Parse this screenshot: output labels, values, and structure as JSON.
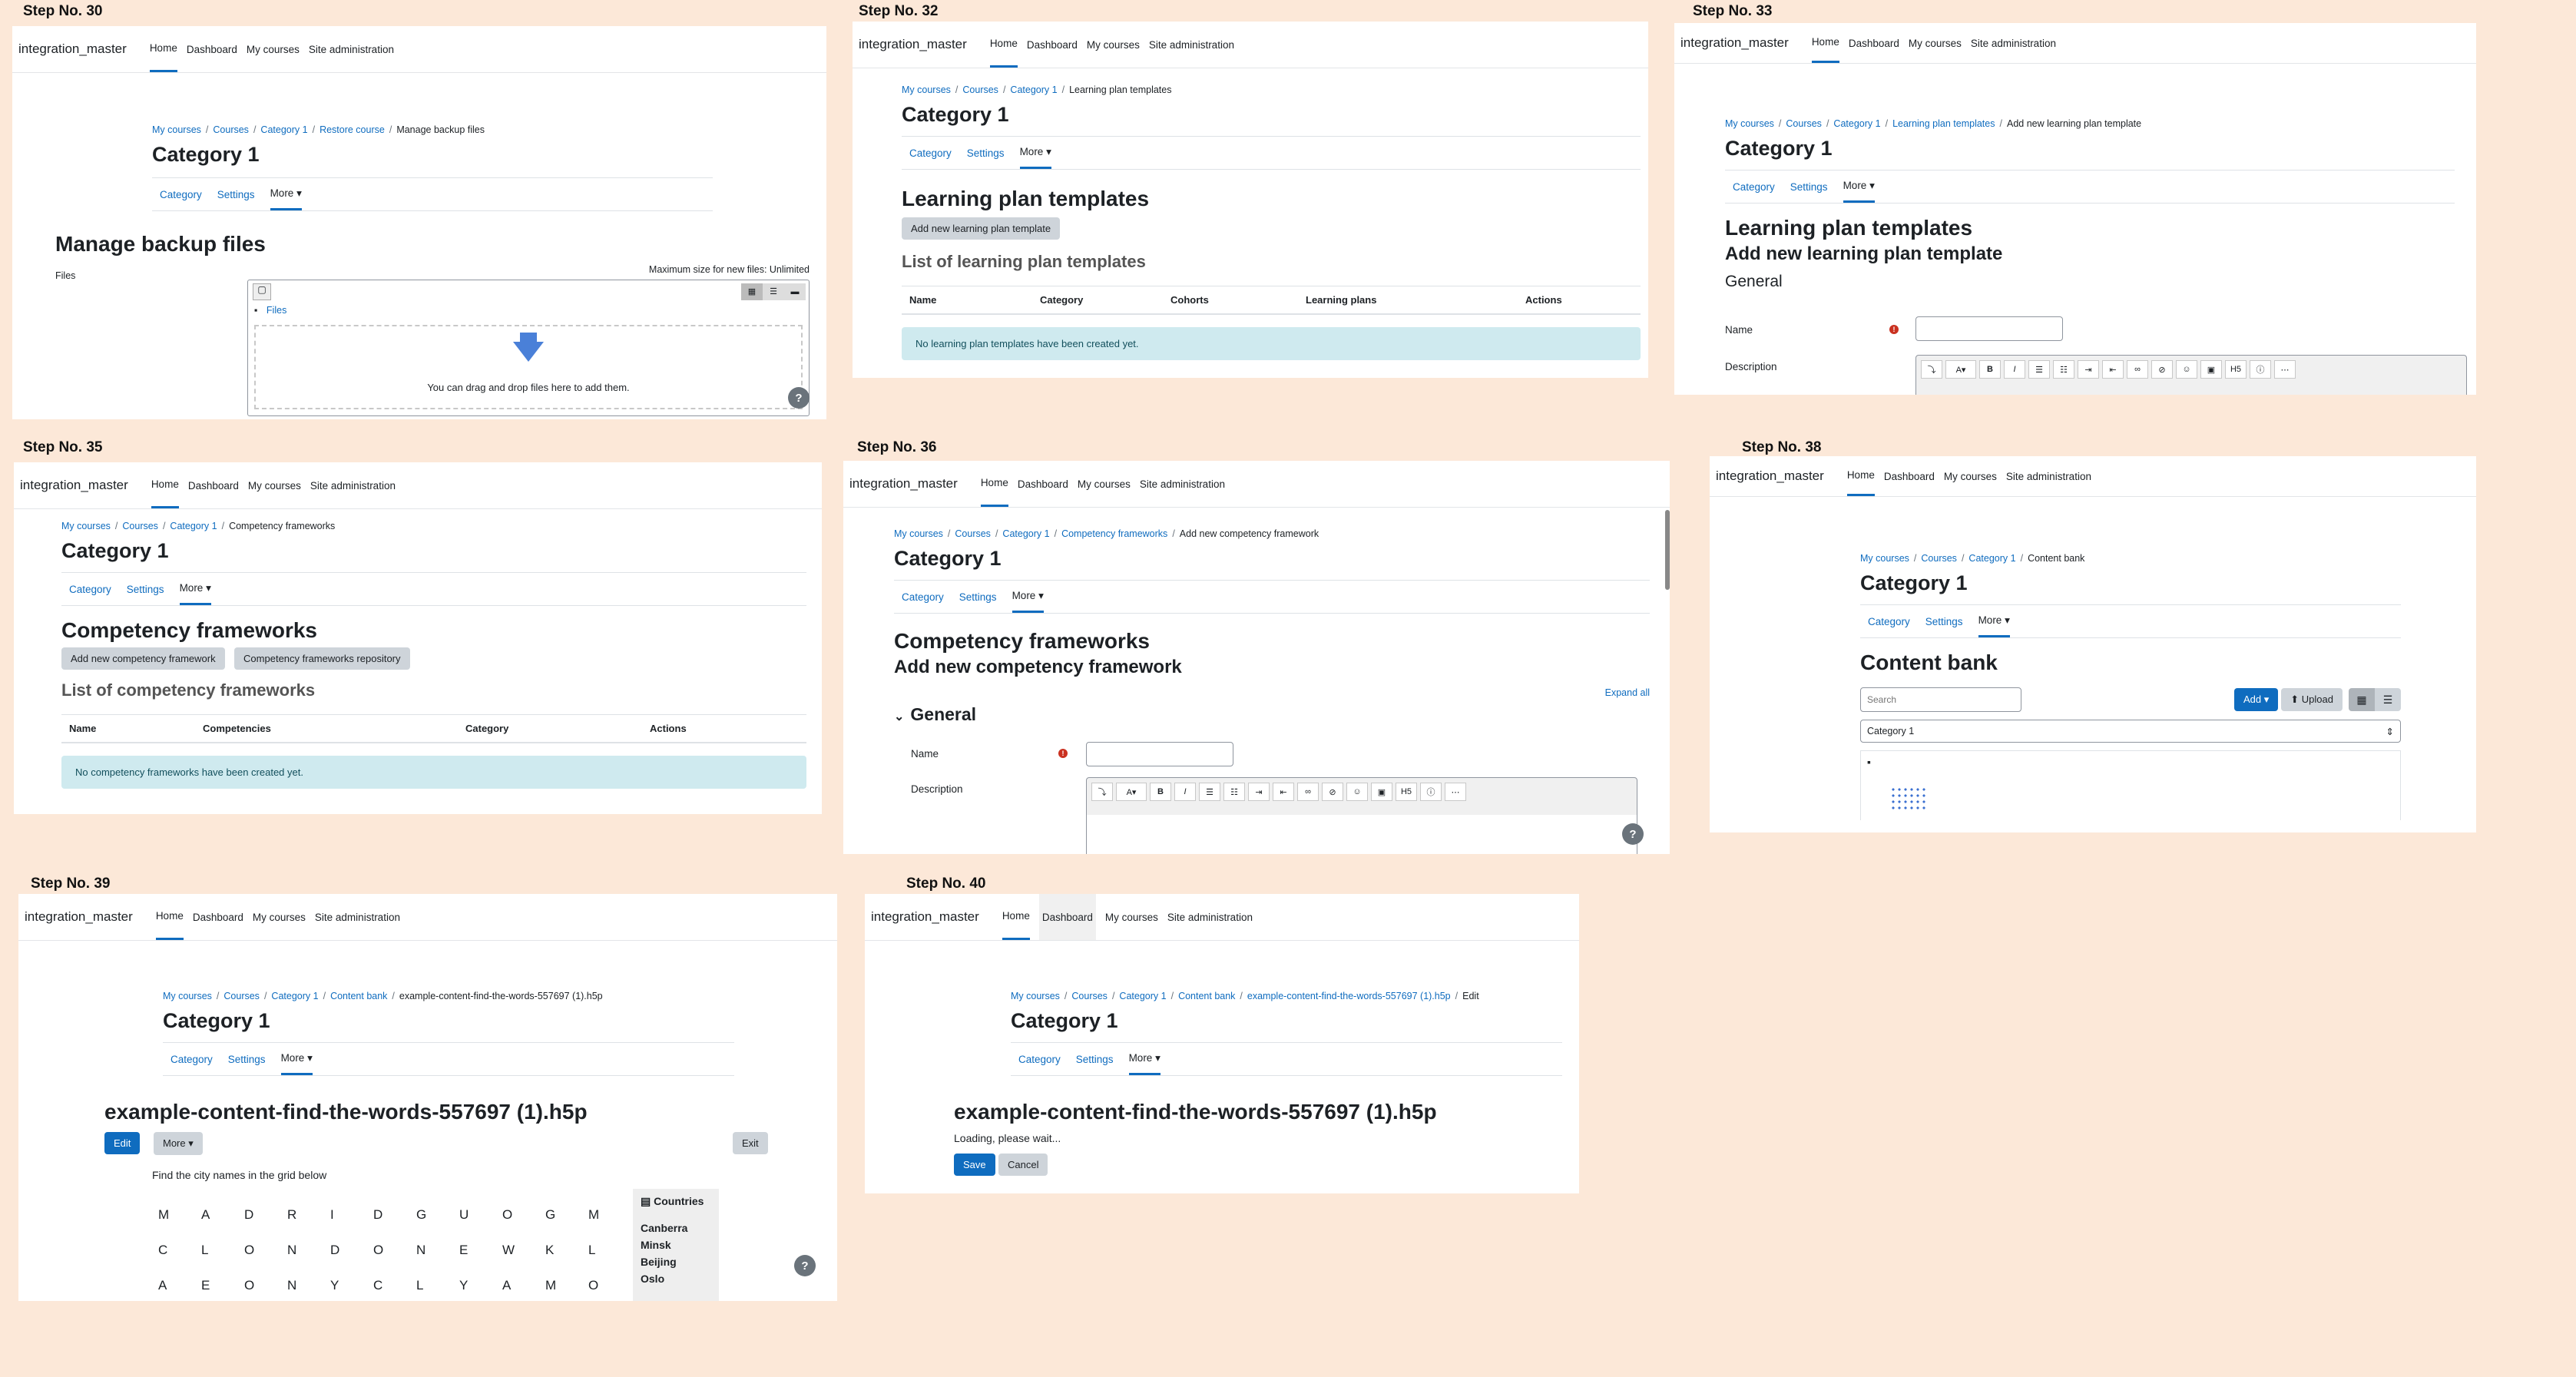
{
  "common": {
    "brand": "integration_master",
    "nav": [
      "Home",
      "Dashboard",
      "My courses",
      "Site administration"
    ],
    "category_title": "Category 1",
    "subnav": [
      "Category",
      "Settings",
      "More ▾"
    ],
    "crumb_mycourses": "My courses",
    "crumb_courses": "Courses",
    "crumb_category": "Category 1",
    "help": "?"
  },
  "s30": {
    "label": "Step No. 30",
    "crumb_restore": "Restore course",
    "crumb_current": "Manage backup files",
    "heading": "Manage backup files",
    "max_size": "Maximum size for new files: Unlimited",
    "files_label": "Files",
    "files_folder": "Files",
    "drop_text": "You can drag and drop files here to add them."
  },
  "s32": {
    "label": "Step No. 32",
    "crumb_current": "Learning plan templates",
    "heading": "Learning plan templates",
    "add_button": "Add new learning plan template",
    "list_heading": "List of learning plan templates",
    "columns": [
      "Name",
      "Category",
      "Cohorts",
      "Learning plans",
      "Actions"
    ],
    "empty": "No learning plan templates have been created yet."
  },
  "s33": {
    "label": "Step No. 33",
    "crumb_templates": "Learning plan templates",
    "crumb_current": "Add new learning plan template",
    "heading": "Learning plan templates",
    "subheading": "Add new learning plan template",
    "section": "General",
    "name_label": "Name",
    "desc_label": "Description"
  },
  "s35": {
    "label": "Step No. 35",
    "crumb_current": "Competency frameworks",
    "heading": "Competency frameworks",
    "add_button": "Add new competency framework",
    "repo_button": "Competency frameworks repository",
    "list_heading": "List of competency frameworks",
    "columns": [
      "Name",
      "Competencies",
      "Category",
      "Actions"
    ],
    "empty": "No competency frameworks have been created yet."
  },
  "s36": {
    "label": "Step No. 36",
    "crumb_frameworks": "Competency frameworks",
    "crumb_current": "Add new competency framework",
    "heading": "Competency frameworks",
    "subheading": "Add new competency framework",
    "expand_all": "Expand all",
    "section": "General",
    "name_label": "Name",
    "desc_label": "Description"
  },
  "s38": {
    "label": "Step No. 38",
    "crumb_current": "Content bank",
    "heading": "Content bank",
    "search_placeholder": "Search",
    "add_button": "Add ▾",
    "upload_button": "Upload",
    "category_select": "Category 1"
  },
  "s39": {
    "label": "Step No. 39",
    "crumb_bank": "Content bank",
    "crumb_current": "example-content-find-the-words-557697 (1).h5p",
    "heading": "example-content-find-the-words-557697 (1).h5p",
    "edit_button": "Edit",
    "more_button": "More ▾",
    "exit_button": "Exit",
    "instruction": "Find the city names in the grid below",
    "grid": [
      [
        "M",
        "A",
        "D",
        "R",
        "I",
        "D",
        "G",
        "U",
        "O",
        "G",
        "M"
      ],
      [
        "C",
        "L",
        "O",
        "N",
        "D",
        "O",
        "N",
        "E",
        "W",
        "K",
        "L"
      ],
      [
        "A",
        "E",
        "O",
        "N",
        "Y",
        "C",
        "L",
        "Y",
        "A",
        "M",
        "O"
      ]
    ],
    "countries_title": "Countries",
    "countries": [
      "Canberra",
      "Minsk",
      "Beijing",
      "Oslo"
    ]
  },
  "s40": {
    "label": "Step No. 40",
    "crumb_bank": "Content bank",
    "crumb_file": "example-content-find-the-words-557697 (1).h5p",
    "crumb_current": "Edit",
    "heading": "example-content-find-the-words-557697 (1).h5p",
    "loading": "Loading, please wait...",
    "save_button": "Save",
    "cancel_button": "Cancel"
  }
}
